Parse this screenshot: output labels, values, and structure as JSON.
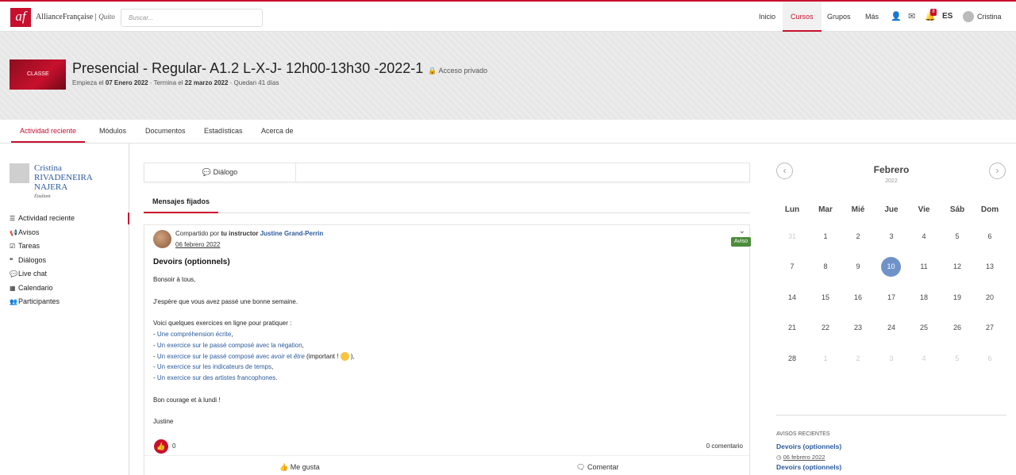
{
  "topbar": {
    "logo_mark": "af",
    "brand": "AllianceFrançaise",
    "city": "Quito",
    "search_placeholder": "Buscar...",
    "nav": [
      "Inicio",
      "Cursos",
      "Grupos",
      "Más"
    ],
    "notifications_count": "8",
    "language": "ES",
    "user": "Cristina",
    "accent_color": "#c8102e"
  },
  "course": {
    "thumb_label": "CLASSE",
    "title": "Presencial - Regular- A1.2 L-X-J- 12h00-13h30 -2022-1",
    "access": "Acceso privado",
    "starts_label": "Empieza el",
    "start_date": "07 Enero 2022",
    "ends_label": "· Termina el",
    "end_date": "22 marzo 2022",
    "remaining": "· Quedan 41 días"
  },
  "tabs": [
    "Actividad reciente",
    "Módulos",
    "Documentos",
    "Estadísticas",
    "Acerca de"
  ],
  "sidebar": {
    "name_first": "Cristina",
    "name_last1": "RIVADENEIRA",
    "name_last2": "NAJERA",
    "role": "Étudiant",
    "items": [
      {
        "label": "Actividad reciente",
        "icon": "☰"
      },
      {
        "label": "Avisos",
        "icon": "📢"
      },
      {
        "label": "Tareas",
        "icon": "☑"
      },
      {
        "label": "Diálogos",
        "icon": "❝"
      },
      {
        "label": "Live chat",
        "icon": "💬"
      },
      {
        "label": "Calendario",
        "icon": "▦"
      },
      {
        "label": "Participantes",
        "icon": "👥"
      }
    ]
  },
  "center": {
    "dialog_button": "Diálogo",
    "pinned_tab": "Mensajes fijados",
    "post": {
      "shared_by": "Compartido por",
      "role": "tu instructor",
      "author": "Justine Grand-Perrin",
      "date": "06 febrero 2022",
      "tag": "Aviso",
      "title": "Devoirs (optionnels)",
      "greeting": "Bonsoir à tous,",
      "p1": "J'espère que vous avez passé une bonne semaine.",
      "p2": "Voici quelques exercices en ligne pour pratiquer :",
      "link1_prefix": "- ",
      "link1": "Une compréhension écrite",
      "link1_suffix": ",",
      "link2": "Un exercice sur le passé composé avec la négation",
      "link2_suffix": ",",
      "link3a": "Un exercice sur le passé composé avec ",
      "link3b": "avoir",
      "link3c": " et ",
      "link3d": "être",
      "link3_suffix": " (important ! ",
      "link3_end": " ),",
      "link4": "Un exercice sur les indicateurs de temps",
      "link4_suffix": ",",
      "link5": "Un exercice sur des artistes francophones",
      "link5_suffix": ".",
      "closing": "Bon courage et à lundi !",
      "signature": "Justine",
      "likes": "0",
      "comments": "0 comentario",
      "like_action": "Me gusta",
      "comment_action": "Comentar"
    }
  },
  "calendar": {
    "month": "Febrero",
    "year": "2022",
    "weekdays": [
      "Lun",
      "Mar",
      "Mié",
      "Jue",
      "Vie",
      "Sáb",
      "Dom"
    ],
    "weeks": [
      [
        "31",
        "1",
        "2",
        "3",
        "4",
        "5",
        "6"
      ],
      [
        "7",
        "8",
        "9",
        "10",
        "11",
        "12",
        "13"
      ],
      [
        "14",
        "15",
        "16",
        "17",
        "18",
        "19",
        "20"
      ],
      [
        "21",
        "22",
        "23",
        "24",
        "25",
        "26",
        "27"
      ],
      [
        "28",
        "1",
        "2",
        "3",
        "4",
        "5",
        "6"
      ]
    ],
    "today": "10"
  },
  "recent": {
    "title": "AVISOS RECIENTES",
    "item1": "Devoirs (optionnels)",
    "item1_date": "06 febrero 2022",
    "item2": "Devoirs (optionnels)"
  }
}
